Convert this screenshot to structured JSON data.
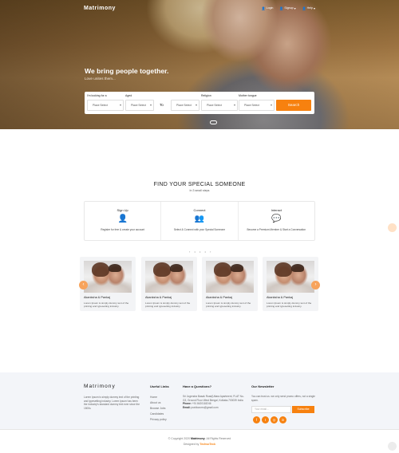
{
  "header": {
    "logo": "Matrimony",
    "nav": [
      {
        "icon": "user-icon",
        "label": "Login"
      },
      {
        "icon": "user-plus-icon",
        "label": "Signup"
      },
      {
        "icon": "help-icon",
        "label": "Help"
      }
    ]
  },
  "hero": {
    "title": "We bring people together.",
    "subtitle": "Love unites them..."
  },
  "search": {
    "looking_label": "I'm looking for a",
    "looking_value": "Place Select",
    "aged_label": "Aged",
    "aged_from": "Place Select",
    "to_label": "To",
    "aged_to": "Place Select",
    "religion_label": "Religion",
    "religion_value": "Place Select",
    "tongue_label": "Mother tongue",
    "tongue_value": "Place Select",
    "button": "Search"
  },
  "steps_section": {
    "title": "FIND YOUR SPECIAL SOMEONE",
    "subtitle": "In 3 small steps",
    "steps": [
      {
        "title": "Sign Up",
        "icon": "user-add-icon",
        "desc": "Register for free & create your account"
      },
      {
        "title": "Connect",
        "icon": "users-icon",
        "desc": "Select & Connect with your Special Someone"
      },
      {
        "title": "Interact",
        "icon": "chat-icon",
        "desc": "Become a Premium Member & Start a Conversation"
      }
    ]
  },
  "stories": {
    "prev": "‹",
    "next": "›",
    "items": [
      {
        "name": "Akanksha & Pankaj",
        "desc": "Lorem Ipsum is simply dummy text of the printing and typesetting industry."
      },
      {
        "name": "Akanksha & Pankaj",
        "desc": "Lorem Ipsum is simply dummy text of the printing and typesetting industry."
      },
      {
        "name": "Akanksha & Pankaj",
        "desc": "Lorem Ipsum is simply dummy text of the printing and typesetting industry."
      },
      {
        "name": "Akanksha & Pankaj",
        "desc": "Lorem Ipsum is simply dummy text of the printing and typesetting industry."
      }
    ]
  },
  "footer": {
    "logo": "Matrimony",
    "about": "Lorem Ipsum is simply dummy text of the printing and typesetting industry. Lorem Ipsum has been the industry's standard dummy text ever since the 1500s",
    "links_title": "Useful Links",
    "links": [
      "Home",
      "About us",
      "Browse Jobs",
      "Candidates",
      "Privacy policy"
    ],
    "contact_title": "Have a Questions?",
    "address": "Sri Jogendra Basak Road(Uttara Apartment, FLAT No- G3, Ground Floor West Bengal, Kolkata-700039 India",
    "phone_label": "Phone:",
    "phone": "+91 8420118246",
    "email_label": "Email:",
    "email": "pushkar.ms@gmail.com",
    "newsletter_title": "Our Newsletter",
    "newsletter_text": "You can trust us. we only send promo offers, not a single spam.",
    "newsletter_placeholder": "Your email...",
    "subscribe": "Subscribe",
    "social": [
      {
        "icon": "facebook-icon",
        "glyph": "f"
      },
      {
        "icon": "twitter-icon",
        "glyph": "t"
      },
      {
        "icon": "instagram-icon",
        "glyph": "◎"
      },
      {
        "icon": "linkedin-icon",
        "glyph": "in"
      }
    ]
  },
  "bottom": {
    "copyright_prefix": "© Copyright 2020",
    "brand": "Matrimony",
    "rights": ". All Rights Reserved",
    "designed_by": "Designed by",
    "designer": "TechsoTeck"
  },
  "colors": {
    "accent": "#f7810f"
  }
}
